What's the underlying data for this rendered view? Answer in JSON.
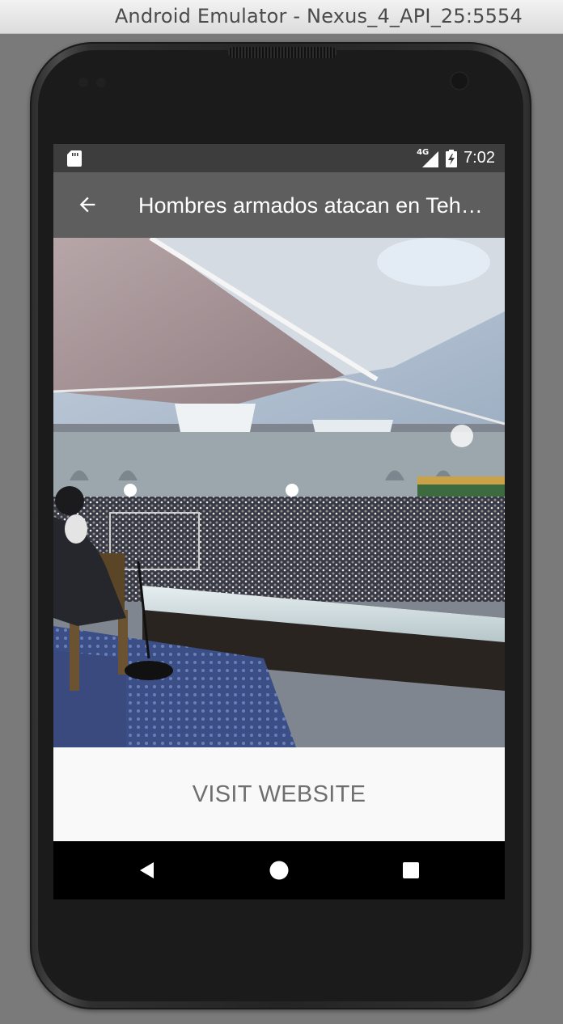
{
  "window": {
    "title": "Android Emulator - Nexus_4_API_25:5554"
  },
  "status_bar": {
    "time": "7:02",
    "network": "4G",
    "icons": [
      "sd-card-icon",
      "signal-icon",
      "battery-charging-icon"
    ]
  },
  "app_bar": {
    "back_icon": "arrow-back-icon",
    "title": "Hombres armados atacan en Teherán"
  },
  "article": {
    "image_description_icon": "news-photo"
  },
  "actions": {
    "visit_label": "VISIT WEBSITE"
  },
  "nav_bar": {
    "icons": [
      "back-triangle-icon",
      "home-circle-icon",
      "recents-square-icon"
    ]
  },
  "colors": {
    "status_bar": "#3d3d3d",
    "app_bar": "#5e5e5e",
    "button_text": "#6f6f6f",
    "nav_bar": "#000000"
  }
}
